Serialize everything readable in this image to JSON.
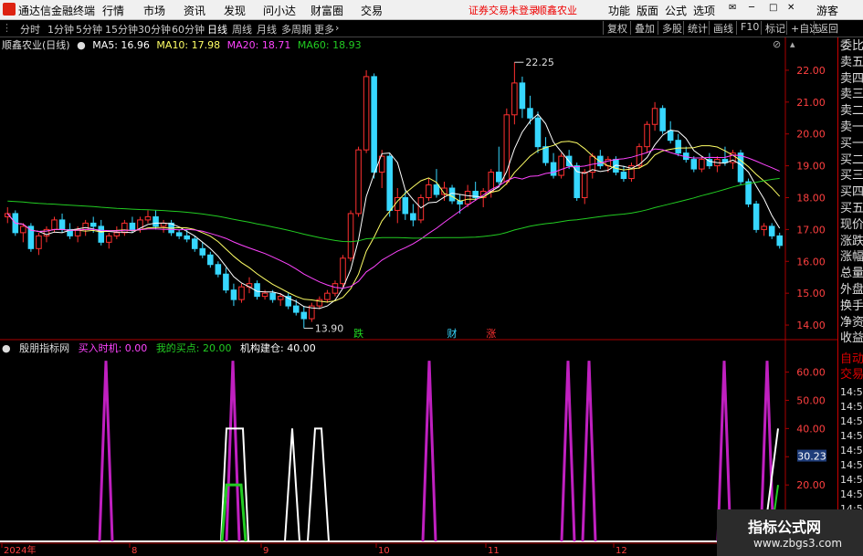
{
  "menubar": {
    "app_title": "通达信金融终端",
    "items": [
      "行情",
      "市场",
      "资讯",
      "发现",
      "问小达",
      "财富圈",
      "交易"
    ],
    "warning": "证券交易未登录",
    "stock": "顺鑫农业",
    "right_items": [
      "功能",
      "版面",
      "公式",
      "选项"
    ],
    "user": "游客"
  },
  "toolbar": {
    "periods": [
      "分时",
      "1分钟",
      "5分钟",
      "15分钟",
      "30分钟",
      "60分钟",
      "日线",
      "周线",
      "月线",
      "多周期",
      "更多"
    ],
    "selected": "日线",
    "right_buttons": [
      "复权",
      "叠加",
      "多股",
      "统计",
      "画线",
      "F10",
      "标记",
      "+自选",
      "返回"
    ]
  },
  "chart_header": {
    "title": "顺鑫农业(日线)",
    "ma5": "MA5: 16.96",
    "ma10": "MA10: 17.98",
    "ma20": "MA20: 18.71",
    "ma60": "MA60: 18.93"
  },
  "colors": {
    "up": "#ff3030",
    "down": "#37d7ff",
    "ma5": "#ffffff",
    "ma10": "#ffff66",
    "ma20": "#ff44ff",
    "ma60": "#22cc22",
    "ind_purple": "#c020c0",
    "ind_green": "#22cc22"
  },
  "price_axis": [
    "22.00",
    "21.00",
    "20.00",
    "19.00",
    "18.00",
    "17.00",
    "16.00",
    "15.00",
    "14.00"
  ],
  "price_markers": {
    "high": "22.25",
    "low": "13.90"
  },
  "candle_tags": [
    "跌",
    "财",
    "涨"
  ],
  "indicator": {
    "name": "殷朋指标网",
    "buy_timing": "买入时机: 0.00",
    "my_buy": "我的买点: 20.00",
    "inst_build": "机构建仓: 40.00",
    "axis": [
      "60.00",
      "50.00",
      "40.00",
      "30.00",
      "20.00"
    ],
    "current": "30.23"
  },
  "sidebar": {
    "items": [
      "委比",
      "卖五",
      "卖四",
      "卖三",
      "卖二",
      "卖一",
      "买一",
      "买二",
      "买三",
      "买四",
      "买五",
      "现价",
      "涨跌",
      "涨幅",
      "总量",
      "外盘",
      "换手",
      "净资",
      "收益"
    ],
    "auto_trade": [
      "自动",
      "交易"
    ],
    "times": [
      "14:56",
      "14:56",
      "14:56",
      "14:56",
      "14:56",
      "14:56",
      "14:56",
      "14:56",
      "14:56"
    ]
  },
  "date_axis": [
    "2024年",
    "8",
    "9",
    "10",
    "11",
    "12"
  ],
  "watermark": {
    "title": "指标公式网",
    "url": "www.zbgs3.com"
  },
  "chart_data": {
    "type": "candlestick",
    "ylim": [
      13.6,
      22.6
    ],
    "ohlc": [
      [
        17.4,
        17.7,
        17.2,
        17.5
      ],
      [
        17.5,
        17.6,
        16.8,
        16.9
      ],
      [
        16.9,
        17.2,
        16.6,
        17.1
      ],
      [
        17.1,
        17.2,
        16.3,
        16.4
      ],
      [
        16.4,
        16.9,
        16.2,
        16.8
      ],
      [
        16.8,
        17.1,
        16.6,
        17.0
      ],
      [
        17.0,
        17.4,
        16.9,
        17.3
      ],
      [
        17.3,
        17.5,
        16.9,
        17.0
      ],
      [
        17.0,
        17.2,
        16.7,
        16.8
      ],
      [
        16.8,
        17.1,
        16.6,
        17.0
      ],
      [
        17.0,
        17.3,
        16.8,
        17.2
      ],
      [
        17.2,
        17.4,
        16.9,
        17.1
      ],
      [
        17.1,
        17.3,
        16.5,
        16.6
      ],
      [
        16.6,
        16.9,
        16.4,
        16.8
      ],
      [
        16.8,
        17.1,
        16.7,
        16.9
      ],
      [
        16.9,
        17.3,
        16.8,
        17.2
      ],
      [
        17.2,
        17.4,
        16.9,
        17.0
      ],
      [
        17.0,
        17.4,
        16.9,
        17.3
      ],
      [
        17.3,
        17.6,
        17.2,
        17.4
      ],
      [
        17.4,
        17.6,
        17.0,
        17.1
      ],
      [
        17.1,
        17.3,
        16.9,
        17.2
      ],
      [
        17.2,
        17.3,
        16.8,
        16.9
      ],
      [
        16.9,
        17.0,
        16.7,
        16.8
      ],
      [
        16.8,
        17.0,
        16.6,
        16.7
      ],
      [
        16.7,
        16.8,
        16.3,
        16.4
      ],
      [
        16.4,
        16.6,
        16.1,
        16.2
      ],
      [
        16.2,
        16.3,
        15.8,
        15.9
      ],
      [
        15.9,
        16.0,
        15.5,
        15.6
      ],
      [
        15.6,
        15.8,
        15.0,
        15.1
      ],
      [
        15.1,
        15.3,
        14.6,
        14.8
      ],
      [
        14.8,
        15.3,
        14.7,
        15.2
      ],
      [
        15.2,
        15.5,
        15.0,
        15.3
      ],
      [
        15.3,
        15.4,
        14.8,
        14.9
      ],
      [
        14.9,
        15.1,
        14.8,
        15.0
      ],
      [
        15.0,
        15.1,
        14.7,
        14.8
      ],
      [
        14.8,
        15.0,
        14.6,
        14.9
      ],
      [
        14.9,
        15.0,
        14.5,
        14.6
      ],
      [
        14.6,
        14.8,
        14.3,
        14.4
      ],
      [
        14.4,
        14.6,
        13.9,
        14.2
      ],
      [
        14.2,
        14.7,
        14.1,
        14.6
      ],
      [
        14.6,
        14.9,
        14.5,
        14.8
      ],
      [
        14.8,
        15.1,
        14.7,
        15.0
      ],
      [
        15.0,
        15.4,
        14.9,
        15.3
      ],
      [
        15.3,
        16.2,
        15.2,
        16.1
      ],
      [
        16.1,
        17.6,
        16.0,
        17.5
      ],
      [
        17.5,
        19.6,
        17.4,
        19.5
      ],
      [
        19.5,
        22.0,
        19.4,
        21.8
      ],
      [
        21.8,
        21.9,
        18.6,
        18.8
      ],
      [
        18.8,
        19.5,
        18.3,
        19.3
      ],
      [
        19.3,
        19.4,
        17.4,
        17.6
      ],
      [
        17.6,
        18.3,
        17.2,
        18.0
      ],
      [
        18.0,
        18.2,
        17.3,
        17.5
      ],
      [
        17.5,
        17.8,
        17.1,
        17.3
      ],
      [
        17.3,
        18.1,
        17.2,
        18.0
      ],
      [
        18.0,
        18.6,
        17.9,
        18.4
      ],
      [
        18.4,
        18.9,
        18.0,
        18.1
      ],
      [
        18.1,
        18.5,
        17.9,
        18.3
      ],
      [
        18.3,
        18.4,
        17.8,
        17.9
      ],
      [
        17.9,
        18.1,
        17.5,
        17.8
      ],
      [
        17.8,
        18.4,
        17.7,
        18.2
      ],
      [
        18.2,
        18.5,
        17.9,
        18.0
      ],
      [
        18.0,
        18.3,
        17.7,
        18.2
      ],
      [
        18.2,
        18.9,
        18.0,
        18.8
      ],
      [
        18.8,
        19.6,
        18.4,
        18.5
      ],
      [
        18.5,
        20.8,
        18.4,
        20.6
      ],
      [
        20.6,
        22.25,
        20.3,
        21.6
      ],
      [
        21.6,
        21.8,
        20.5,
        20.8
      ],
      [
        20.8,
        21.2,
        20.3,
        20.5
      ],
      [
        20.5,
        20.7,
        19.4,
        19.6
      ],
      [
        19.6,
        19.9,
        19.0,
        19.1
      ],
      [
        19.1,
        19.4,
        18.6,
        18.7
      ],
      [
        18.7,
        19.4,
        18.6,
        19.3
      ],
      [
        19.3,
        19.5,
        18.9,
        19.0
      ],
      [
        19.0,
        19.1,
        17.9,
        18.0
      ],
      [
        18.0,
        18.9,
        17.8,
        18.8
      ],
      [
        18.8,
        19.4,
        18.6,
        19.3
      ],
      [
        19.3,
        19.5,
        18.9,
        19.0
      ],
      [
        19.0,
        19.3,
        18.8,
        19.2
      ],
      [
        19.2,
        19.3,
        18.7,
        18.8
      ],
      [
        18.8,
        19.0,
        18.5,
        18.6
      ],
      [
        18.6,
        19.1,
        18.5,
        19.0
      ],
      [
        19.0,
        19.7,
        18.9,
        19.6
      ],
      [
        19.6,
        20.4,
        19.4,
        20.3
      ],
      [
        20.3,
        21.0,
        20.1,
        20.8
      ],
      [
        20.8,
        20.9,
        20.0,
        20.1
      ],
      [
        20.1,
        20.4,
        19.7,
        19.8
      ],
      [
        19.8,
        20.0,
        19.3,
        19.4
      ],
      [
        19.4,
        19.6,
        19.1,
        19.2
      ],
      [
        19.2,
        19.3,
        18.8,
        18.9
      ],
      [
        18.9,
        19.3,
        18.8,
        19.2
      ],
      [
        19.2,
        19.4,
        18.9,
        19.0
      ],
      [
        19.0,
        19.3,
        18.8,
        19.2
      ],
      [
        19.2,
        19.6,
        19.0,
        19.1
      ],
      [
        19.1,
        19.5,
        18.9,
        19.4
      ],
      [
        19.4,
        19.5,
        18.4,
        18.5
      ],
      [
        18.5,
        18.6,
        17.7,
        17.8
      ],
      [
        17.8,
        17.9,
        16.9,
        17.0
      ],
      [
        17.0,
        17.2,
        16.8,
        17.1
      ],
      [
        17.1,
        17.2,
        16.7,
        16.8
      ],
      [
        16.8,
        16.9,
        16.4,
        16.5
      ]
    ]
  }
}
